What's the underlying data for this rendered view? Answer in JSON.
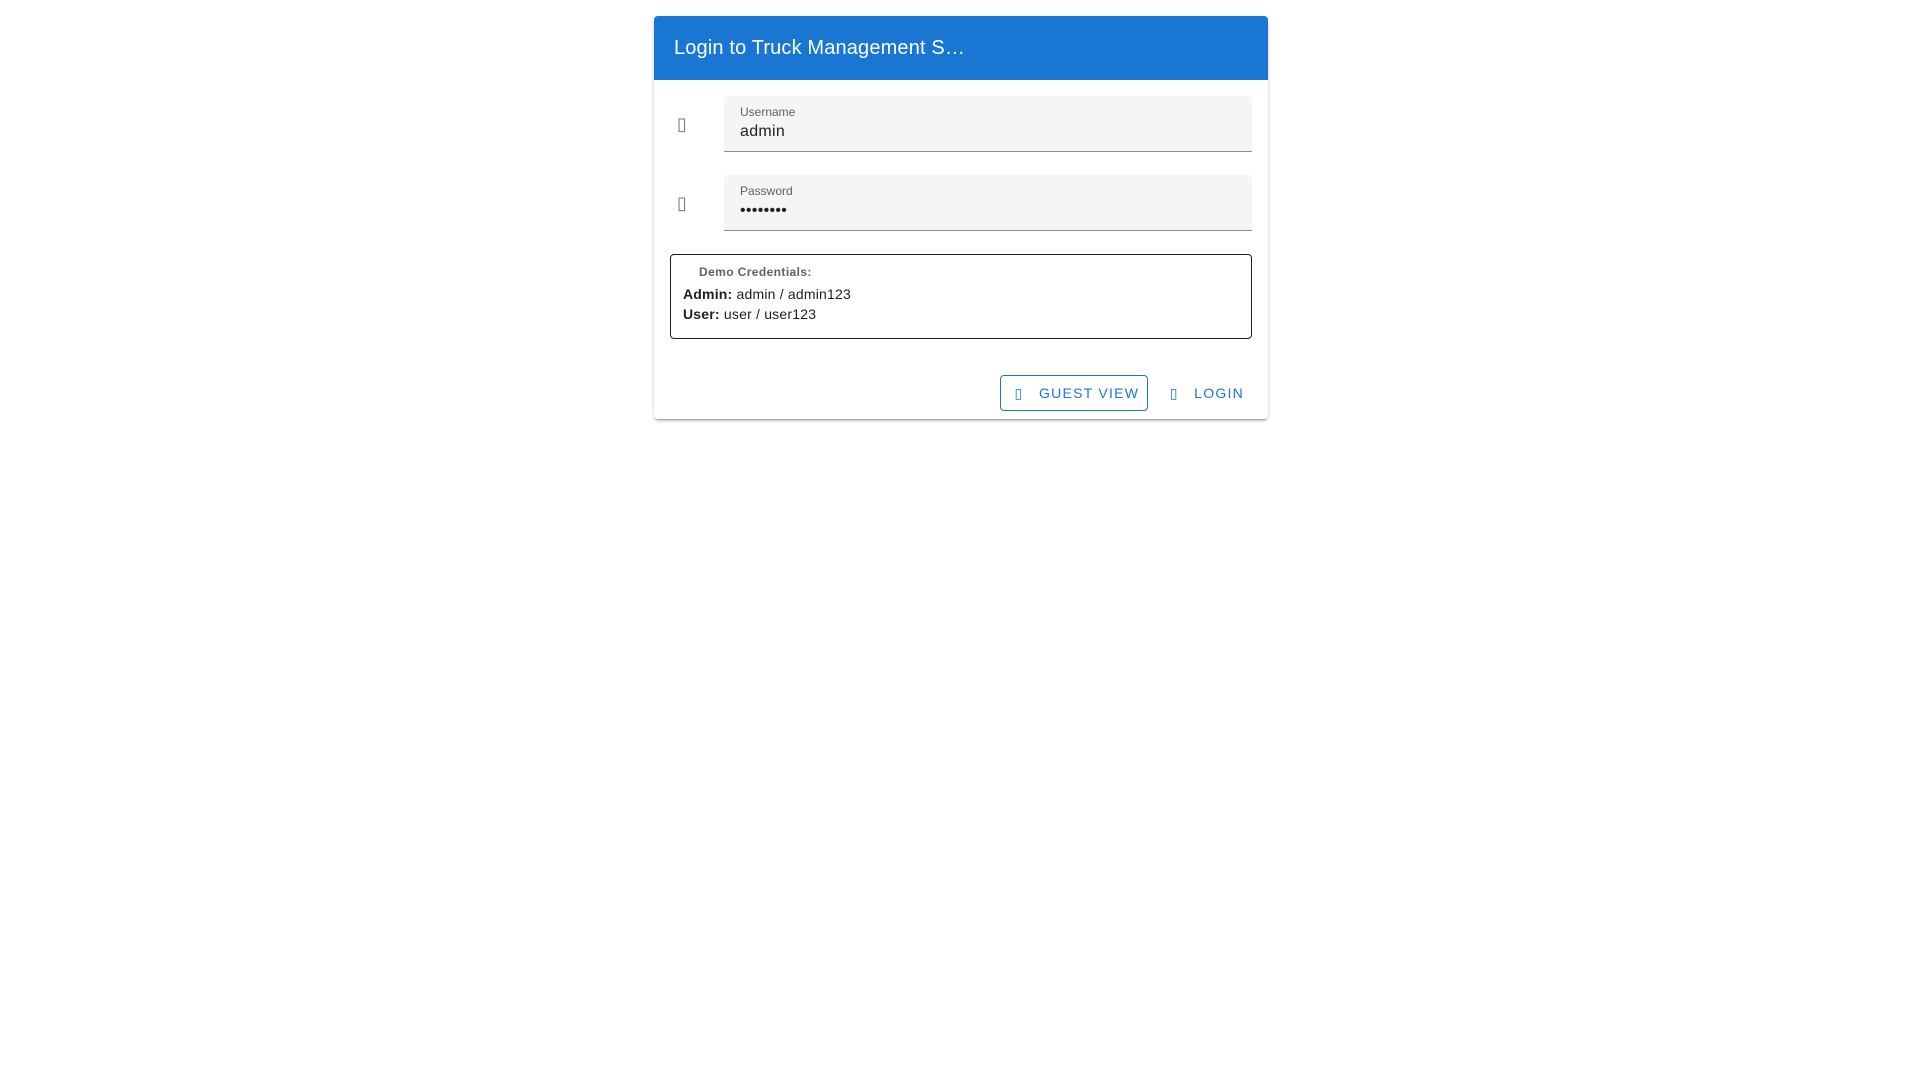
{
  "dialog": {
    "title": "Login to Truck Management S…"
  },
  "form": {
    "username": {
      "label": "Username",
      "value": "admin",
      "icon": "account-icon"
    },
    "password": {
      "label": "Password",
      "value": "••••••••",
      "icon": "lock-icon"
    }
  },
  "demo": {
    "title": "Demo Credentials:",
    "lines": [
      {
        "key": "Admin:",
        "value": "admin / admin123"
      },
      {
        "key": "User:",
        "value": "user / user123"
      }
    ]
  },
  "actions": {
    "guest_label": "Guest View",
    "login_label": "Login"
  },
  "colors": {
    "primary": "#1976d2",
    "field_bg": "#f5f5f5",
    "icon": "#757575"
  }
}
